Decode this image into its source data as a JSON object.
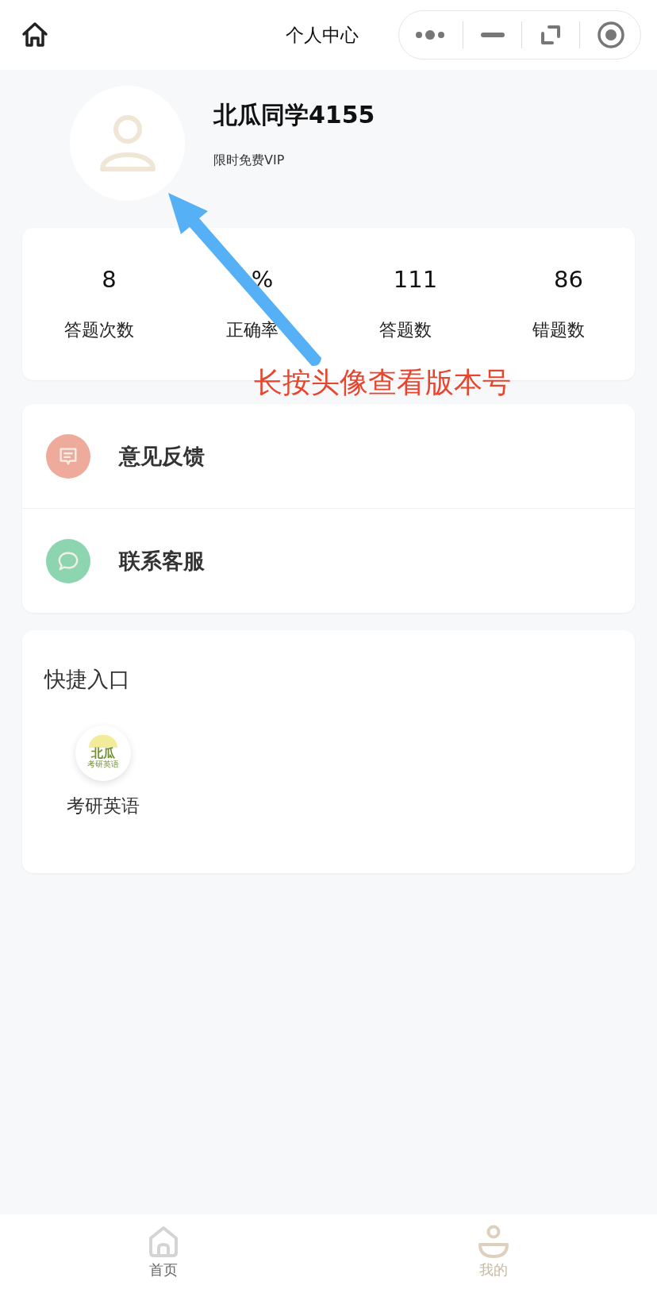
{
  "nav_bar": {
    "title": "个人中心"
  },
  "profile": {
    "name": "北瓜同学4155",
    "badge": "限时免费VIP"
  },
  "stats": [
    {
      "value": "8",
      "label": "答题次数"
    },
    {
      "value": "%",
      "label": "正确率"
    },
    {
      "value": "111",
      "label": "答题数"
    },
    {
      "value": "86",
      "label": "错题数"
    }
  ],
  "annotation": {
    "text": "长按头像查看版本号"
  },
  "menu": [
    {
      "kind": "feedback",
      "label": "意见反馈",
      "color": "#eeaa9a"
    },
    {
      "kind": "service",
      "label": "联系客服",
      "color": "#8dd5b0"
    }
  ],
  "shortcuts": {
    "title": "快捷入口",
    "items": [
      {
        "label": "考研英语",
        "logo_lines": [
          "北瓜",
          "考研英语"
        ]
      }
    ]
  },
  "tab_bar": [
    {
      "kind": "home",
      "label": "首页",
      "selected": false
    },
    {
      "kind": "profile",
      "label": "我的",
      "selected": true
    }
  ]
}
